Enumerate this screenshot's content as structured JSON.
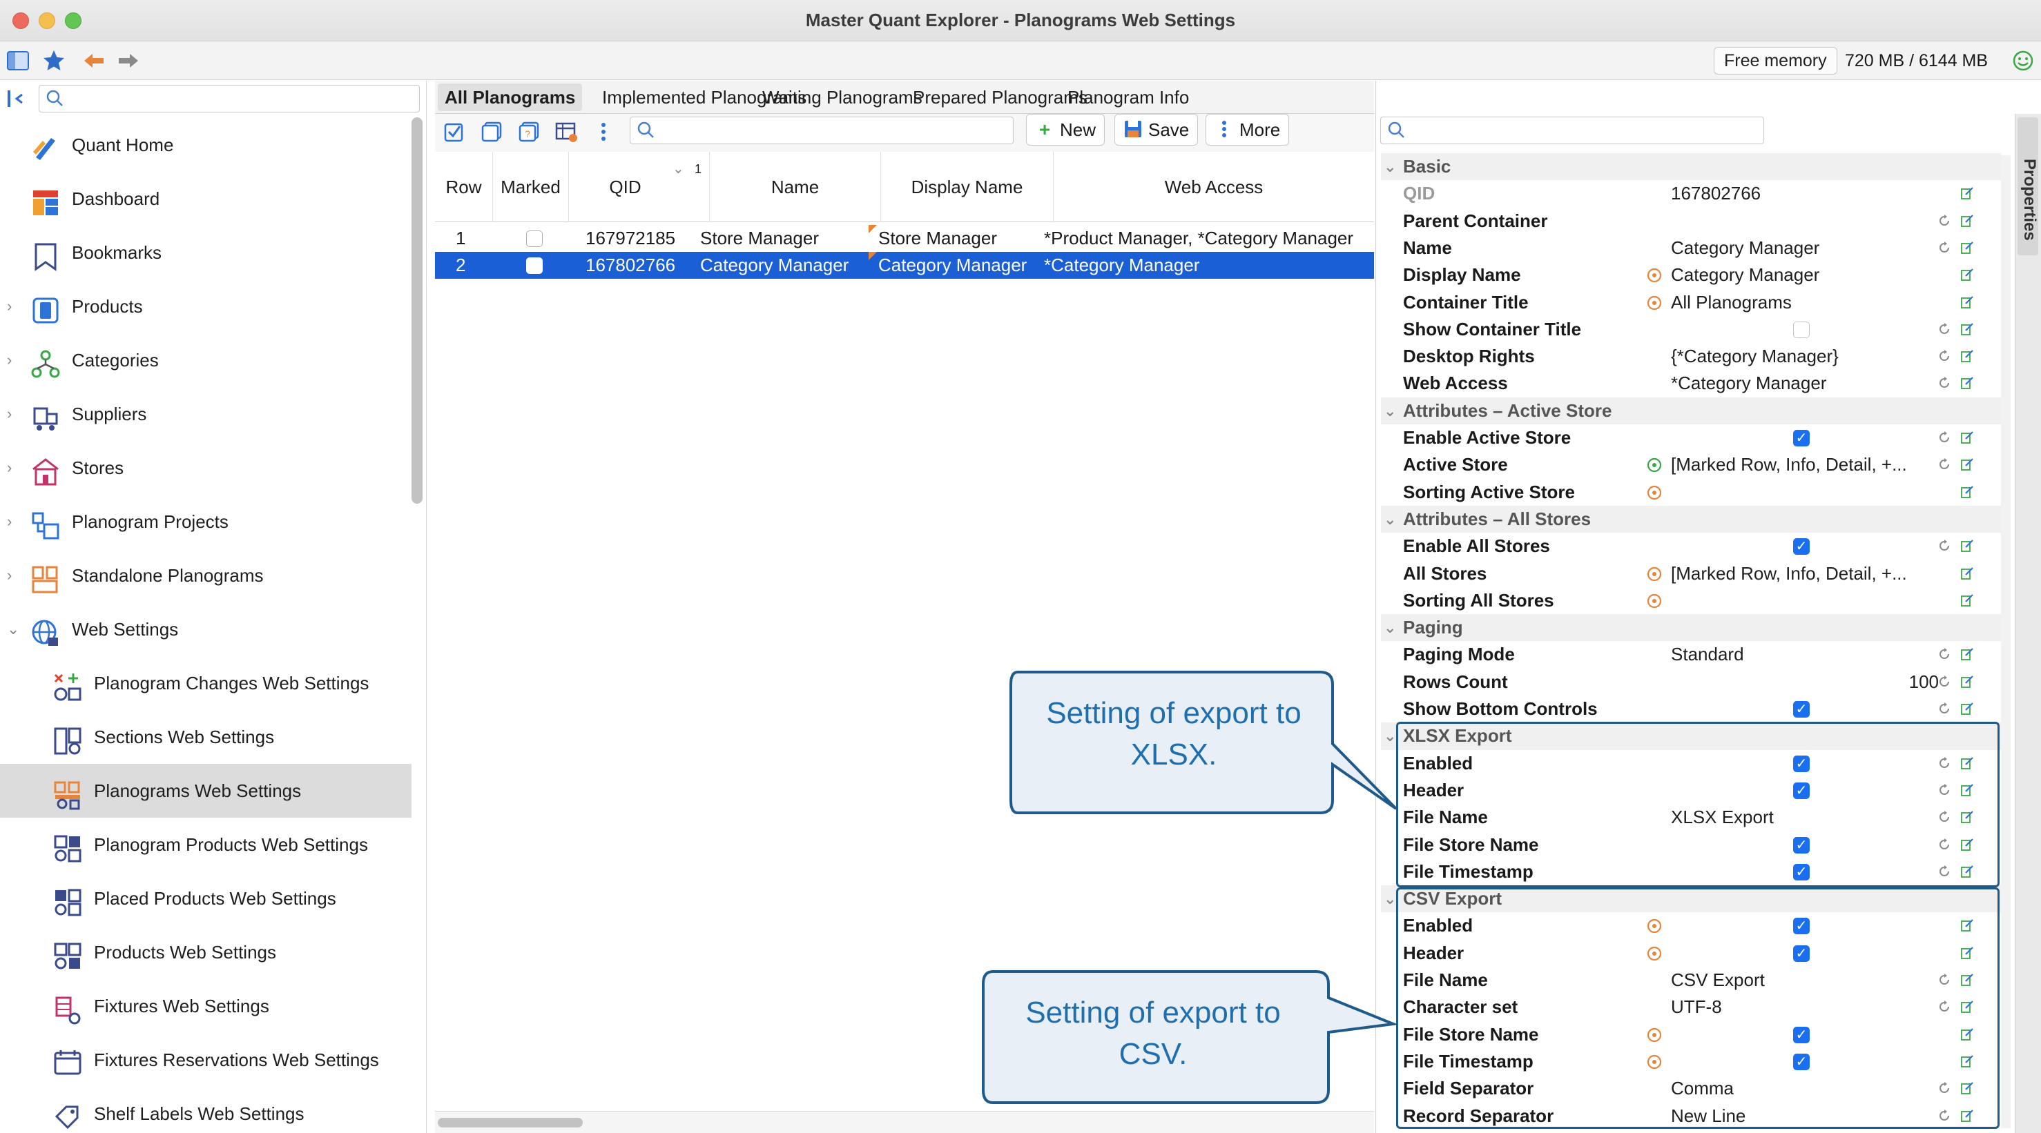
{
  "window": {
    "title": "Master Quant Explorer - Planograms Web Settings"
  },
  "toolbar": {
    "free_memory_label": "Free memory",
    "memory_value": "720 MB / 6144 MB"
  },
  "sidebar": {
    "items": [
      {
        "label": "Quant Home",
        "icon": "quant-home-icon"
      },
      {
        "label": "Dashboard",
        "icon": "dashboard-icon"
      },
      {
        "label": "Bookmarks",
        "icon": "bookmark-icon"
      },
      {
        "label": "Products",
        "icon": "products-icon"
      },
      {
        "label": "Categories",
        "icon": "categories-icon"
      },
      {
        "label": "Suppliers",
        "icon": "suppliers-icon"
      },
      {
        "label": "Stores",
        "icon": "stores-icon"
      },
      {
        "label": "Planogram Projects",
        "icon": "planogram-projects-icon"
      },
      {
        "label": "Standalone Planograms",
        "icon": "standalone-planograms-icon"
      },
      {
        "label": "Web Settings",
        "icon": "web-settings-icon"
      },
      {
        "label": "Planogram Changes Web Settings",
        "icon": "planogram-changes-icon"
      },
      {
        "label": "Sections Web Settings",
        "icon": "sections-icon"
      },
      {
        "label": "Planograms Web Settings",
        "icon": "planograms-web-icon"
      },
      {
        "label": "Planogram Products Web Settings",
        "icon": "planogram-products-icon"
      },
      {
        "label": "Placed Products Web Settings",
        "icon": "placed-products-icon"
      },
      {
        "label": "Products Web Settings",
        "icon": "products-web-icon"
      },
      {
        "label": "Fixtures Web Settings",
        "icon": "fixtures-icon"
      },
      {
        "label": "Fixtures Reservations Web Settings",
        "icon": "fixtures-reservations-icon"
      },
      {
        "label": "Shelf Labels Web Settings",
        "icon": "shelf-labels-icon"
      }
    ]
  },
  "tabs": [
    "All Planograms",
    "Implemented Planograms",
    "Waiting Planograms",
    "Prepared Planograms",
    "Planogram Info"
  ],
  "table_toolbar": {
    "new_label": "New",
    "save_label": "Save",
    "more_label": "More"
  },
  "table": {
    "columns": [
      "Row",
      "Marked",
      "QID",
      "Name",
      "Display Name",
      "Web Access"
    ],
    "sort_index": "1",
    "rows": [
      {
        "row": "1",
        "qid": "167972185",
        "name": "Store Manager",
        "display_name": "Store Manager",
        "web_access": "*Product Manager, *Category Manager"
      },
      {
        "row": "2",
        "qid": "167802766",
        "name": "Category Manager",
        "display_name": "Category Manager",
        "web_access": "*Category Manager"
      }
    ]
  },
  "properties": {
    "side_label": "Properties",
    "rows": [
      {
        "type": "group",
        "label": "Basic"
      },
      {
        "label": "QID",
        "value": "167802766",
        "dim": true
      },
      {
        "label": "Parent Container",
        "value": ""
      },
      {
        "label": "Name",
        "value": "Category Manager"
      },
      {
        "label": "Display Name",
        "value": "Category Manager"
      },
      {
        "label": "Container Title",
        "value": "All Planograms"
      },
      {
        "label": "Show Container Title",
        "value": ""
      },
      {
        "label": "Desktop Rights",
        "value": "{*Category Manager}"
      },
      {
        "label": "Web Access",
        "value": "*Category Manager"
      },
      {
        "type": "group",
        "label": "Attributes – Active Store"
      },
      {
        "label": "Enable Active Store",
        "value": ""
      },
      {
        "label": "Active Store",
        "value": "[Marked Row, Info, Detail, +..."
      },
      {
        "label": "Sorting Active Store",
        "value": ""
      },
      {
        "type": "group",
        "label": "Attributes – All Stores"
      },
      {
        "label": "Enable All Stores",
        "value": ""
      },
      {
        "label": "All Stores",
        "value": "[Marked Row, Info, Detail, +..."
      },
      {
        "label": "Sorting All Stores",
        "value": ""
      },
      {
        "type": "group",
        "label": "Paging"
      },
      {
        "label": "Paging Mode",
        "value": "Standard"
      },
      {
        "label": "Rows Count",
        "value": "100"
      },
      {
        "label": "Show Bottom Controls",
        "value": ""
      },
      {
        "type": "group",
        "label": "XLSX Export"
      },
      {
        "label": "Enabled",
        "value": ""
      },
      {
        "label": "Header",
        "value": ""
      },
      {
        "label": "File Name",
        "value": "XLSX Export"
      },
      {
        "label": "File Store Name",
        "value": ""
      },
      {
        "label": "File Timestamp",
        "value": ""
      },
      {
        "type": "group",
        "label": "CSV Export"
      },
      {
        "label": "Enabled",
        "value": ""
      },
      {
        "label": "Header",
        "value": ""
      },
      {
        "label": "File Name",
        "value": "CSV Export"
      },
      {
        "label": "Character set",
        "value": "UTF-8"
      },
      {
        "label": "File Store Name",
        "value": ""
      },
      {
        "label": "File Timestamp",
        "value": ""
      },
      {
        "label": "Field Separator",
        "value": "Comma"
      },
      {
        "label": "Record Separator",
        "value": "New Line"
      }
    ]
  },
  "callouts": {
    "xlsx": "Setting of export to XLSX.",
    "csv": "Setting of export to CSV."
  },
  "colors": {
    "selection": "#1a5fd6",
    "checkbox": "#1a6ef0",
    "callout_border": "#1f5a8a",
    "callout_text": "#1f6fb0",
    "callout_fill": "#e8eff6"
  }
}
